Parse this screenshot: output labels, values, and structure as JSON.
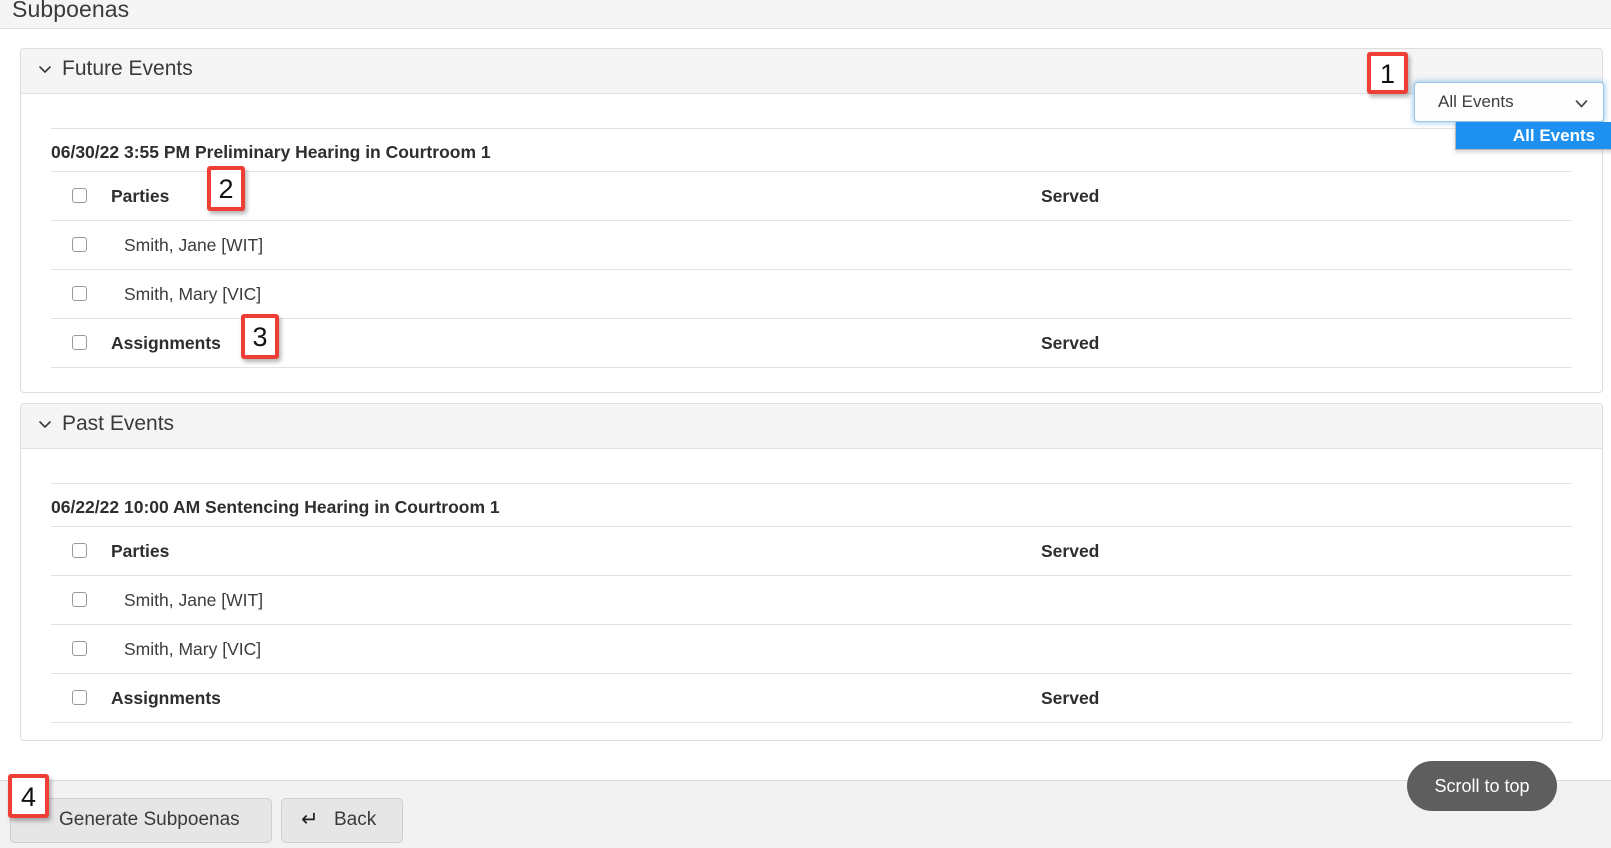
{
  "header": {
    "title": "Subpoenas"
  },
  "filter": {
    "selected": "All Events",
    "caret_icon": "chevron-down-icon",
    "options": [
      "All Events"
    ]
  },
  "sections": [
    {
      "id": "future",
      "title": "Future Events",
      "chevron_icon": "chevron-down-icon",
      "event_title": "06/30/22 3:55 PM Preliminary Hearing in Courtroom 1",
      "rows": [
        {
          "label": "Parties",
          "bold": true,
          "served": "Served"
        },
        {
          "label": "Smith, Jane [WIT]",
          "bold": false,
          "served": ""
        },
        {
          "label": "Smith, Mary [VIC]",
          "bold": false,
          "served": ""
        },
        {
          "label": "Assignments",
          "bold": true,
          "served": "Served"
        }
      ]
    },
    {
      "id": "past",
      "title": "Past Events",
      "chevron_icon": "chevron-down-icon",
      "event_title": "06/22/22 10:00 AM Sentencing Hearing in Courtroom 1",
      "rows": [
        {
          "label": "Parties",
          "bold": true,
          "served": "Served"
        },
        {
          "label": "Smith, Jane [WIT]",
          "bold": false,
          "served": ""
        },
        {
          "label": "Smith, Mary [VIC]",
          "bold": false,
          "served": ""
        },
        {
          "label": "Assignments",
          "bold": true,
          "served": "Served"
        }
      ]
    }
  ],
  "footer": {
    "generate_label": "Generate Subpoenas",
    "back_label": "Back",
    "back_icon": "return-arrow-icon",
    "scroll_top_label": "Scroll to top"
  },
  "annotations": [
    {
      "number": "1"
    },
    {
      "number": "2"
    },
    {
      "number": "3"
    },
    {
      "number": "4"
    }
  ],
  "colors": {
    "accent_blue": "#1e90f0",
    "marker_red": "#ef3e36",
    "section_bg": "#f5f5f5",
    "scroll_btn": "#5e5e5e"
  }
}
